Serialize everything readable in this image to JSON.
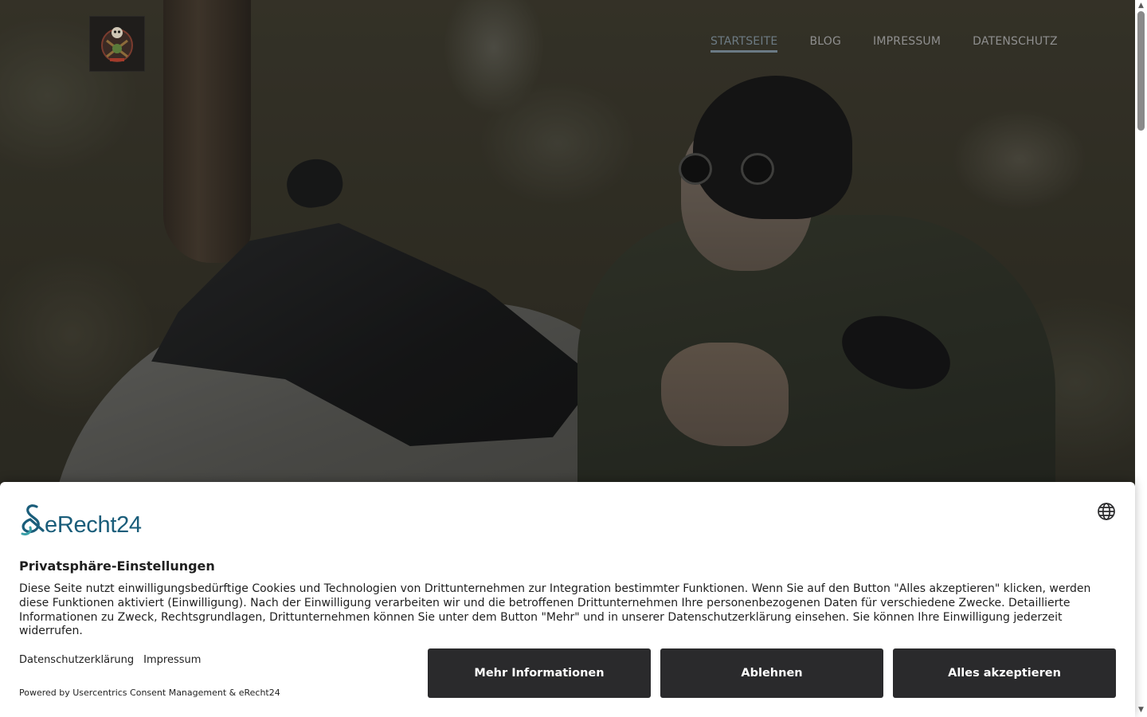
{
  "nav": {
    "items": [
      {
        "label": "STARTSEITE",
        "active": true
      },
      {
        "label": "BLOG",
        "active": false
      },
      {
        "label": "IMPRESSUM",
        "active": false
      },
      {
        "label": "DATENSCHUTZ",
        "active": false
      }
    ]
  },
  "logo": {
    "icon": "skull-emblem-icon"
  },
  "consent": {
    "brand": "eRecht24",
    "title": "Privatsphäre-Einstellungen",
    "text": "Diese Seite nutzt einwilligungsbedürftige Cookies und Technologien von Drittunternehmen zur Integration bestimmter Funktionen. Wenn Sie auf den Button \"Alles akzeptieren\" klicken, werden diese Funktionen aktiviert (Einwilligung). Nach der Einwilligung verarbeiten wir und die betroffenen Drittunternehmen Ihre personenbezogenen Daten für verschiedene Zwecke. Detaillierte Informationen zu Zweck, Rechtsgrundlagen, Drittunternehmen können Sie unter dem Button \"Mehr\" und in unserer Datenschutzerklärung einsehen. Sie können Ihre Einwilligung jederzeit widerrufen.",
    "links": {
      "privacy": "Datenschutzerklärung",
      "imprint": "Impressum"
    },
    "powered_by": "Powered by Usercentrics Consent Management & eRecht24",
    "buttons": {
      "more": "Mehr Informationen",
      "deny": "Ablehnen",
      "accept": "Alles akzeptieren"
    },
    "language_icon": "globe-icon"
  },
  "colors": {
    "nav_active": "#6b7a85",
    "nav_text": "#8f8f8f",
    "brand": "#1a5d7a",
    "button_bg": "#2a2a2c"
  }
}
